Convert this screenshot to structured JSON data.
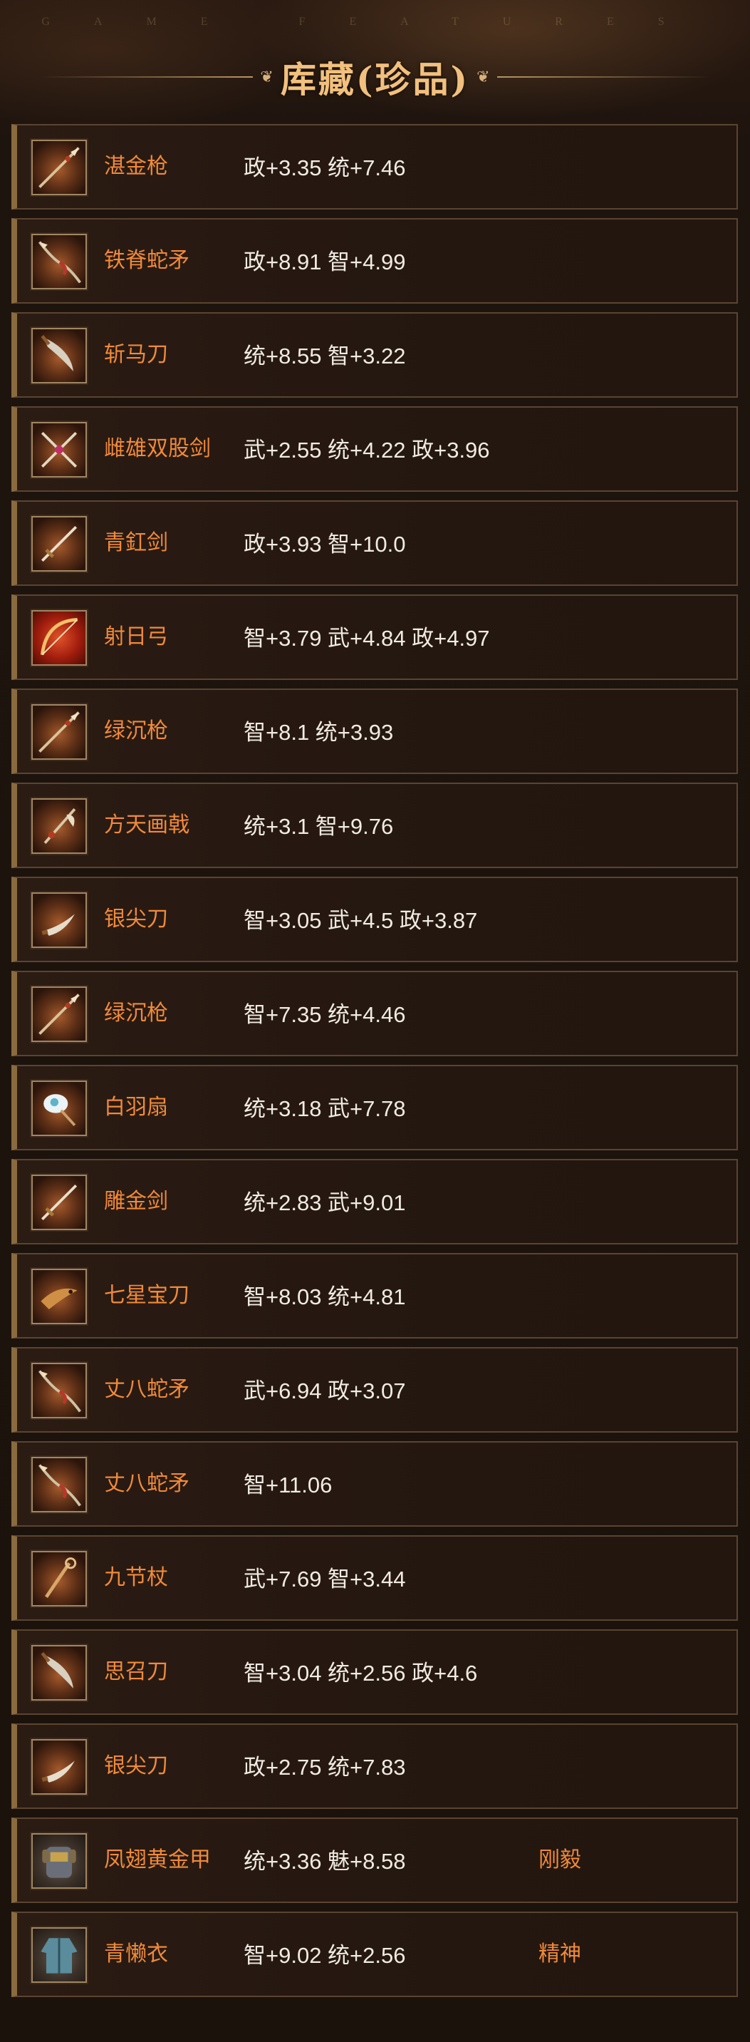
{
  "header": {
    "subtitle": "GAME FEATURES",
    "title": "库藏(珍品)",
    "ornament_left": "❦",
    "ornament_right": "❦"
  },
  "items": [
    {
      "name": "湛金枪",
      "stats": "政+3.35 统+7.46",
      "tag": "",
      "icon": "spear-icon"
    },
    {
      "name": "铁脊蛇矛",
      "stats": "政+8.91 智+4.99",
      "tag": "",
      "icon": "snake-spear-icon"
    },
    {
      "name": "斩马刀",
      "stats": "统+8.55 智+3.22",
      "tag": "",
      "icon": "blade-icon"
    },
    {
      "name": "雌雄双股剑",
      "stats": "武+2.55 统+4.22 政+3.96",
      "tag": "",
      "icon": "twin-swords-icon"
    },
    {
      "name": "青釭剑",
      "stats": "政+3.93 智+10.0",
      "tag": "",
      "icon": "sword-icon"
    },
    {
      "name": "射日弓",
      "stats": "智+3.79 武+4.84 政+4.97",
      "tag": "",
      "icon": "bow-icon"
    },
    {
      "name": "绿沉枪",
      "stats": "智+8.1 统+3.93",
      "tag": "",
      "icon": "spear-icon"
    },
    {
      "name": "方天画戟",
      "stats": "统+3.1 智+9.76",
      "tag": "",
      "icon": "halberd-icon"
    },
    {
      "name": "银尖刀",
      "stats": "智+3.05 武+4.5 政+3.87",
      "tag": "",
      "icon": "knife-icon"
    },
    {
      "name": "绿沉枪",
      "stats": "智+7.35 统+4.46",
      "tag": "",
      "icon": "spear-icon"
    },
    {
      "name": "白羽扇",
      "stats": "统+3.18 武+7.78",
      "tag": "",
      "icon": "feather-fan-icon"
    },
    {
      "name": "雕金剑",
      "stats": "统+2.83 武+9.01",
      "tag": "",
      "icon": "sword-icon"
    },
    {
      "name": "七星宝刀",
      "stats": "智+8.03 统+4.81",
      "tag": "",
      "icon": "dragon-blade-icon"
    },
    {
      "name": "丈八蛇矛",
      "stats": "武+6.94 政+3.07",
      "tag": "",
      "icon": "snake-spear-icon"
    },
    {
      "name": "丈八蛇矛",
      "stats": "智+11.06",
      "tag": "",
      "icon": "snake-spear-icon"
    },
    {
      "name": "九节杖",
      "stats": "武+7.69 智+3.44",
      "tag": "",
      "icon": "staff-icon"
    },
    {
      "name": "思召刀",
      "stats": "智+3.04 统+2.56 政+4.6",
      "tag": "",
      "icon": "blade-icon"
    },
    {
      "name": "银尖刀",
      "stats": "政+2.75 统+7.83",
      "tag": "",
      "icon": "knife-icon"
    },
    {
      "name": "凤翅黄金甲",
      "stats": "统+3.36 魅+8.58",
      "tag": "刚毅",
      "icon": "armor-icon"
    },
    {
      "name": "青懒衣",
      "stats": "智+9.02 统+2.56",
      "tag": "精神",
      "icon": "robe-icon"
    }
  ]
}
